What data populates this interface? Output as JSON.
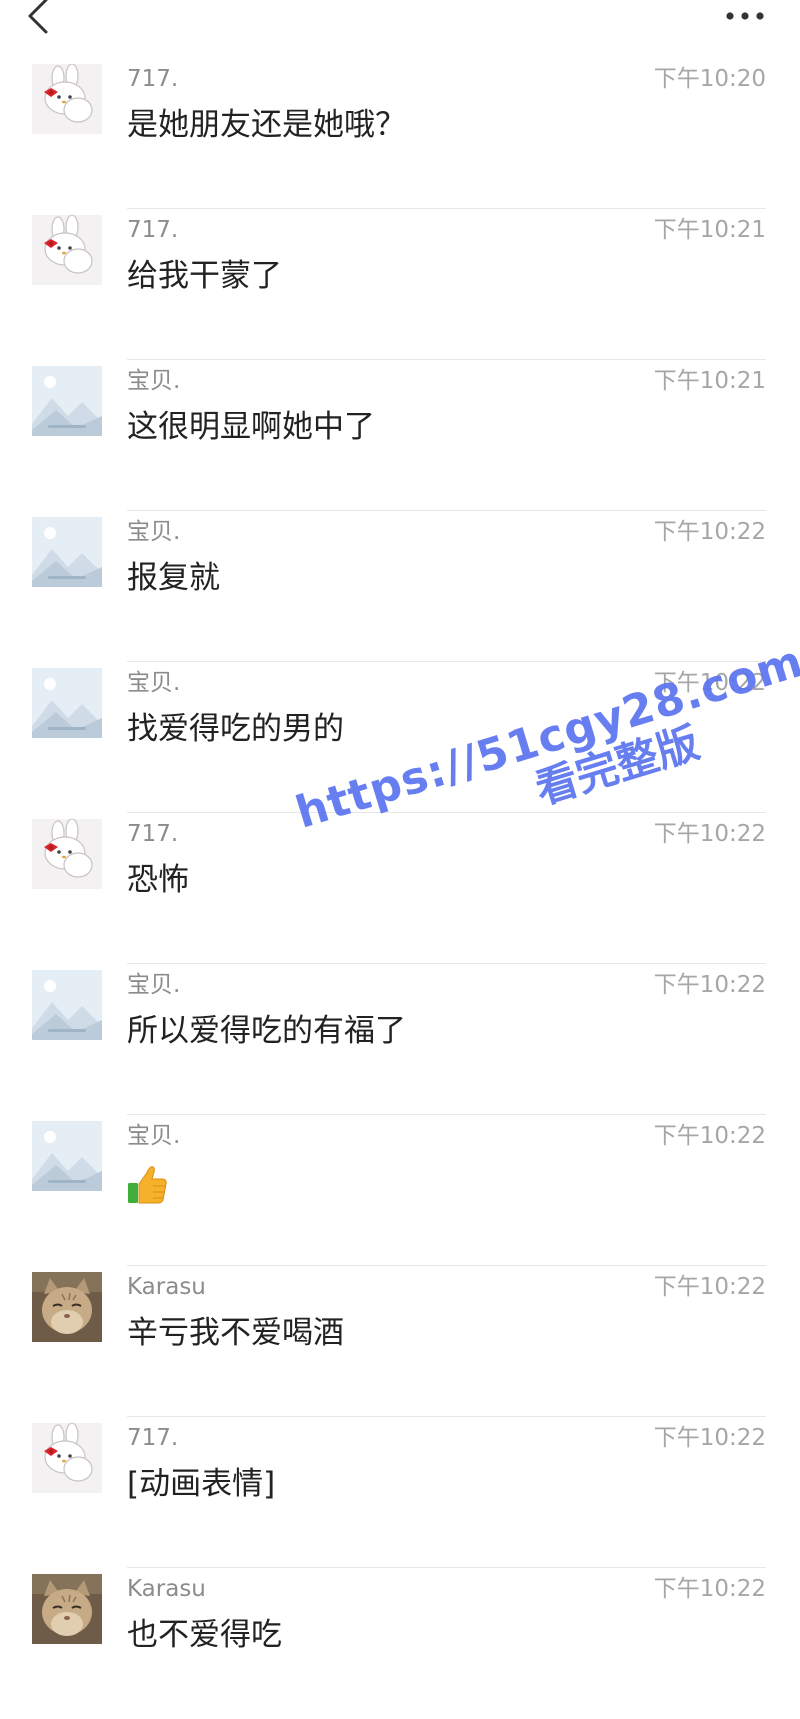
{
  "header": {
    "back_icon": "chevron-left-icon",
    "more_icon": "ellipsis-horizontal-icon"
  },
  "messages": [
    {
      "sender": "717.",
      "avatar": "bunny-cartoon",
      "time": "下午10:20",
      "text": "是她朋友还是她哦？"
    },
    {
      "sender": "717.",
      "avatar": "bunny-cartoon",
      "time": "下午10:21",
      "text": "给我干蒙了"
    },
    {
      "sender": "宝贝.",
      "avatar": "placeholder-image",
      "time": "下午10:21",
      "text": "这很明显啊她中了"
    },
    {
      "sender": "宝贝.",
      "avatar": "placeholder-image",
      "time": "下午10:22",
      "text": "报复就"
    },
    {
      "sender": "宝贝.",
      "avatar": "placeholder-image",
      "time": "下午10:22",
      "text": "找爱得吃的男的"
    },
    {
      "sender": "717.",
      "avatar": "bunny-cartoon",
      "time": "下午10:22",
      "text": "恐怖"
    },
    {
      "sender": "宝贝.",
      "avatar": "placeholder-image",
      "time": "下午10:22",
      "text": "所以爱得吃的有福了"
    },
    {
      "sender": "宝贝.",
      "avatar": "placeholder-image",
      "time": "下午10:22",
      "text": "",
      "emoji": "thumbs-up-icon"
    },
    {
      "sender": "Karasu",
      "avatar": "cat-photo",
      "time": "下午10:22",
      "text": "辛亏我不爱喝酒"
    },
    {
      "sender": "717.",
      "avatar": "bunny-cartoon",
      "time": "下午10:22",
      "text": "[动画表情]"
    },
    {
      "sender": "Karasu",
      "avatar": "cat-photo",
      "time": "下午10:22",
      "text": "也不爱得吃"
    }
  ],
  "watermark": {
    "url": "https://51cgy28.com",
    "subtitle": "看完整版",
    "color": "#5b74f0"
  },
  "colors": {
    "sender": "#8c8c8c",
    "time": "#a6a6a6",
    "text": "#222222",
    "divider": "#e6e6e6"
  }
}
